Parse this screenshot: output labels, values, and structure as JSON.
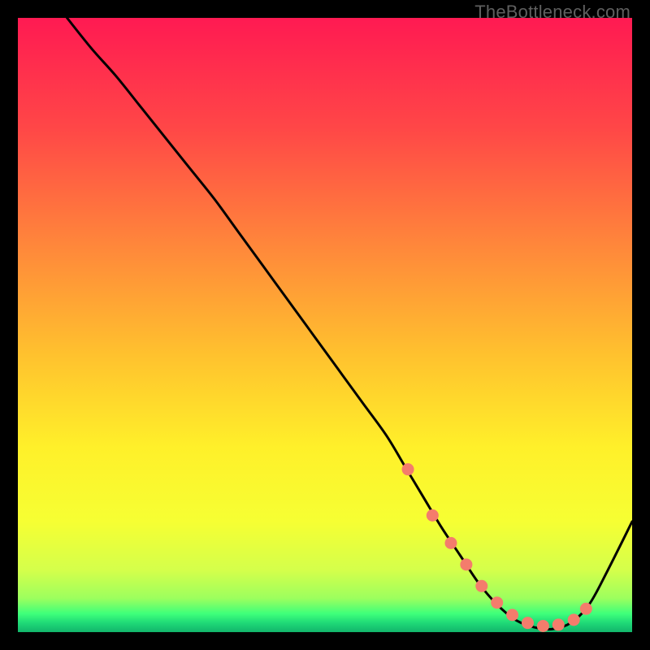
{
  "watermark": "TheBottleneck.com",
  "chart_data": {
    "type": "line",
    "title": "",
    "xlabel": "",
    "ylabel": "",
    "xlim": [
      0,
      100
    ],
    "ylim": [
      0,
      100
    ],
    "series": [
      {
        "name": "bottleneck-curve",
        "x": [
          8,
          12,
          16,
          20,
          24,
          28,
          32,
          36,
          40,
          44,
          48,
          52,
          56,
          60,
          63,
          66,
          69,
          72,
          75,
          78,
          81,
          84,
          87,
          90,
          93,
          96,
          100
        ],
        "y": [
          100,
          95,
          90.5,
          85.5,
          80.5,
          75.5,
          70.5,
          65,
          59.5,
          54,
          48.5,
          43,
          37.5,
          32,
          27,
          22,
          17,
          12.5,
          8,
          4.5,
          2,
          0.8,
          0.5,
          1.5,
          4.5,
          10,
          18
        ]
      }
    ],
    "markers": {
      "name": "highlight-dots",
      "x": [
        63.5,
        67.5,
        70.5,
        73,
        75.5,
        78,
        80.5,
        83,
        85.5,
        88,
        90.5,
        92.5
      ],
      "y": [
        26.5,
        19,
        14.5,
        11,
        7.5,
        4.8,
        2.8,
        1.5,
        1,
        1.2,
        2,
        3.8
      ]
    },
    "gradient_stops": [
      {
        "offset": 0.0,
        "color": "#ff1a52"
      },
      {
        "offset": 0.18,
        "color": "#ff4747"
      },
      {
        "offset": 0.38,
        "color": "#ff8a3a"
      },
      {
        "offset": 0.55,
        "color": "#ffc22e"
      },
      {
        "offset": 0.7,
        "color": "#fff02a"
      },
      {
        "offset": 0.82,
        "color": "#f6ff33"
      },
      {
        "offset": 0.9,
        "color": "#d4ff4b"
      },
      {
        "offset": 0.945,
        "color": "#9cff5e"
      },
      {
        "offset": 0.97,
        "color": "#3eff7a"
      },
      {
        "offset": 0.985,
        "color": "#1fd977"
      },
      {
        "offset": 1.0,
        "color": "#12b56b"
      }
    ],
    "marker_color": "#f47c6c",
    "line_color": "#000000"
  }
}
